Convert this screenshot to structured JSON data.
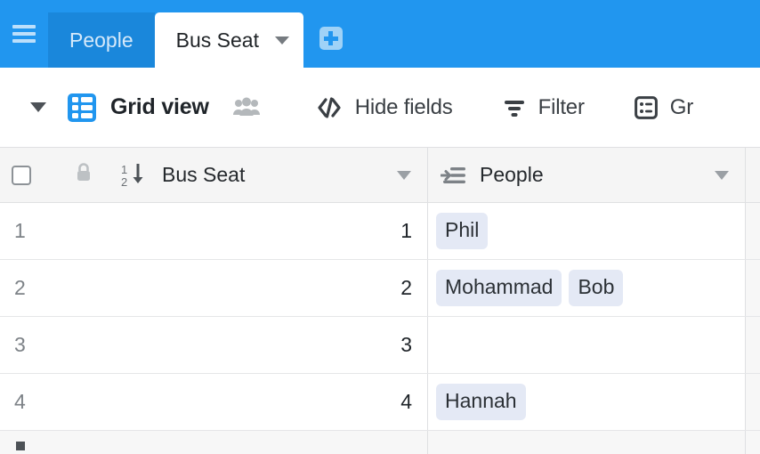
{
  "tabbar": {
    "menu_icon": "hamburger-icon",
    "tabs": [
      {
        "label": "People",
        "active": false
      },
      {
        "label": "Bus Seat",
        "active": true
      }
    ],
    "add_tab_icon": "plus-icon",
    "accent": "#2196ef",
    "inactive_tab_bg": "#1a87db"
  },
  "toolbar": {
    "view_caret_icon": "chevron-down-icon",
    "view_icon": "grid-view-icon",
    "view_name": "Grid view",
    "collaborators_icon": "people-group-icon",
    "buttons": [
      {
        "label": "Hide fields",
        "icon": "hide-fields-icon"
      },
      {
        "label": "Filter",
        "icon": "filter-funnel-icon"
      },
      {
        "label": "Gr",
        "icon": "group-icon"
      }
    ]
  },
  "grid": {
    "select_all_icon": "checkbox-icon",
    "columns": [
      {
        "name": "Bus Seat",
        "icon": "number-sort-icon",
        "lock_icon": "lock-icon",
        "caret_icon": "chevron-down-icon"
      },
      {
        "name": "People",
        "icon": "link-to-record-icon",
        "caret_icon": "chevron-down-icon"
      }
    ],
    "rows": [
      {
        "number": "1",
        "bus_seat": "1",
        "people": [
          "Phil"
        ]
      },
      {
        "number": "2",
        "bus_seat": "2",
        "people": [
          "Mohammad",
          "Bob"
        ]
      },
      {
        "number": "3",
        "bus_seat": "3",
        "people": []
      },
      {
        "number": "4",
        "bus_seat": "4",
        "people": [
          "Hannah"
        ]
      }
    ],
    "add_row_icon": "plus-icon",
    "pill_color": "#e4e9f5"
  }
}
